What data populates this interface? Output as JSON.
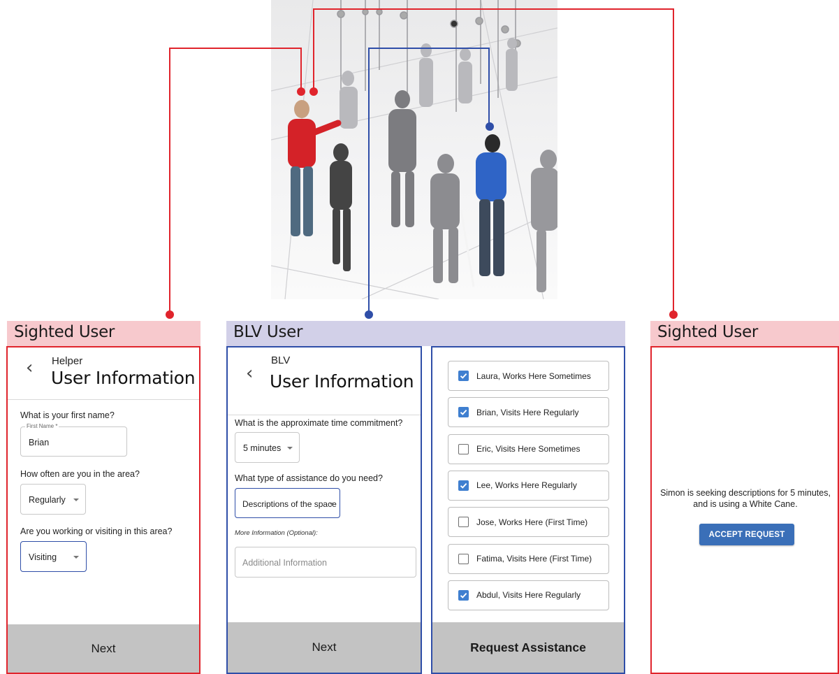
{
  "headers": {
    "left": "Sighted User",
    "middle": "BLV User",
    "right": "Sighted User"
  },
  "helper_screen": {
    "subtitle": "Helper",
    "title": "User Information",
    "q1": "What is your first name?",
    "q1_legend": "First Name *",
    "q1_value": "Brian",
    "q2": "How often are you in the area?",
    "q2_value": "Regularly",
    "q3": "Are you working or visiting in this area?",
    "q3_value": "Visiting",
    "footer": "Next"
  },
  "blv_screen": {
    "subtitle": "BLV",
    "title": "User Information",
    "q1": "What is the approximate time commitment?",
    "q1_value": "5 minutes",
    "q2": "What type of assistance do you need?",
    "q2_value": "Descriptions of the space",
    "more_info_label": "More Information (Optional):",
    "more_info_placeholder": "Additional Information",
    "footer": "Next"
  },
  "select_screen": {
    "items": [
      {
        "label": "Laura, Works Here Sometimes",
        "checked": true
      },
      {
        "label": "Brian, Visits Here Regularly",
        "checked": true
      },
      {
        "label": "Eric, Visits Here Sometimes",
        "checked": false
      },
      {
        "label": "Lee, Works Here Regularly",
        "checked": true
      },
      {
        "label": "Jose, Works Here (First Time)",
        "checked": false
      },
      {
        "label": "Fatima, Visits Here (First Time)",
        "checked": false
      },
      {
        "label": "Abdul, Visits Here Regularly",
        "checked": true
      }
    ],
    "footer": "Request Assistance"
  },
  "request_screen": {
    "message": "Simon is seeking descriptions for 5 minutes, and is using a White Cane.",
    "button": "ACCEPT REQUEST"
  },
  "colors": {
    "sighted": "#e0242c",
    "blv": "#2f4ea8",
    "checkbox": "#3f7fd0",
    "accept": "#3a6fb8"
  }
}
